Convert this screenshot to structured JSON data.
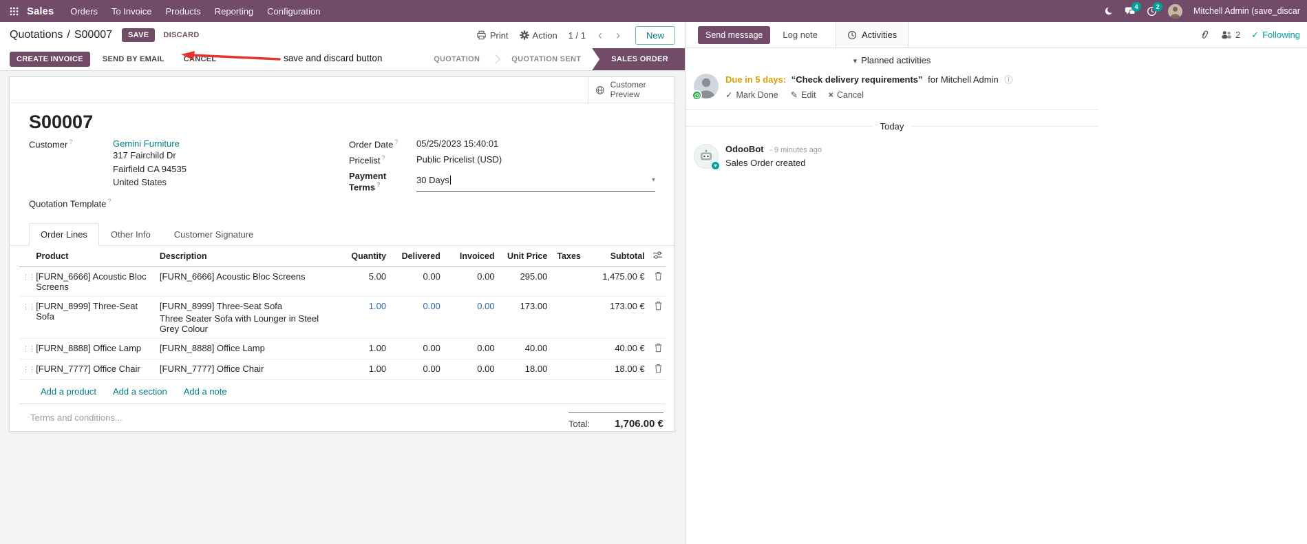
{
  "icons": {
    "help": "?",
    "prev": "‹",
    "next": "›",
    "caret_down": "▾",
    "check": "✓",
    "pencil": "✎",
    "cross": "×",
    "info": "ⓘ",
    "handle": "⋮⋮",
    "heart": "♥"
  },
  "topbar": {
    "app": "Sales",
    "menus": [
      "Orders",
      "To Invoice",
      "Products",
      "Reporting",
      "Configuration"
    ],
    "chat_badge": "4",
    "activity_badge": "2",
    "user": "Mitchell Admin (save_discar"
  },
  "control": {
    "breadcrumb_parent": "Quotations",
    "breadcrumb_sep": "/",
    "breadcrumb_current": "S00007",
    "save": "SAVE",
    "discard": "DISCARD",
    "annotation": "save and discard button",
    "print": "Print",
    "action": "Action",
    "pager": "1 / 1",
    "new": "New"
  },
  "statusbar": {
    "create_invoice": "CREATE INVOICE",
    "send_by_email": "SEND BY EMAIL",
    "cancel": "CANCEL",
    "stages": [
      {
        "label": "QUOTATION"
      },
      {
        "label": "QUOTATION SENT"
      },
      {
        "label": "SALES ORDER"
      }
    ]
  },
  "form": {
    "preview": "Customer Preview",
    "title": "S00007",
    "customer_label": "Customer",
    "customer": "Gemini Furniture",
    "address": [
      "317 Fairchild Dr",
      "Fairfield CA 94535",
      "United States"
    ],
    "quotation_template_label": "Quotation Template",
    "order_date_label": "Order Date",
    "order_date": "05/25/2023 15:40:01",
    "pricelist_label": "Pricelist",
    "pricelist": "Public Pricelist (USD)",
    "payment_terms_label": "Payment Terms",
    "payment_terms": "30 Days",
    "tabs": [
      "Order Lines",
      "Other Info",
      "Customer Signature"
    ]
  },
  "lines": {
    "headers": [
      "Product",
      "Description",
      "Quantity",
      "Delivered",
      "Invoiced",
      "Unit Price",
      "Taxes",
      "Subtotal"
    ],
    "rows": [
      {
        "product": "[FURN_6666] Acoustic Bloc Screens",
        "description": "[FURN_6666] Acoustic Bloc Screens",
        "quantity": "5.00",
        "delivered": "0.00",
        "invoiced": "0.00",
        "unit_price": "295.00",
        "taxes": "",
        "subtotal": "1,475.00 €"
      },
      {
        "product": "[FURN_8999] Three-Seat Sofa",
        "description": "[FURN_8999] Three-Seat Sofa",
        "description2": "Three Seater Sofa with Lounger in Steel Grey Colour",
        "quantity": "1.00",
        "delivered": "0.00",
        "invoiced": "0.00",
        "unit_price": "173.00",
        "taxes": "",
        "subtotal": "173.00 €"
      },
      {
        "product": "[FURN_8888] Office Lamp",
        "description": "[FURN_8888] Office Lamp",
        "quantity": "1.00",
        "delivered": "0.00",
        "invoiced": "0.00",
        "unit_price": "40.00",
        "taxes": "",
        "subtotal": "40.00 €"
      },
      {
        "product": "[FURN_7777] Office Chair",
        "description": "[FURN_7777] Office Chair",
        "quantity": "1.00",
        "delivered": "0.00",
        "invoiced": "0.00",
        "unit_price": "18.00",
        "taxes": "",
        "subtotal": "18.00 €"
      }
    ],
    "add_product": "Add a product",
    "add_section": "Add a section",
    "add_note": "Add a note",
    "terms_placeholder": "Terms and conditions...",
    "total_label": "Total:",
    "total": "1,706.00 €"
  },
  "chatter": {
    "send_message": "Send message",
    "log_note": "Log note",
    "activities_tab": "Activities",
    "followers_count": "2",
    "following": "Following",
    "planned_title": "Planned activities",
    "activity": {
      "due": "Due in 5 days:",
      "summary": "“Check delivery requirements”",
      "assignee": "for Mitchell Admin",
      "mark_done": "Mark Done",
      "edit": "Edit",
      "cancel": "Cancel"
    },
    "date_divider": "Today",
    "message": {
      "author": "OdooBot",
      "time": "- 9 minutes ago",
      "body": "Sales Order created"
    }
  },
  "colors": {
    "primary": "#714B67",
    "link": "#017E84",
    "highlight_blue": "#2E64B0",
    "warning": "#D9A000",
    "badge_teal": "#00A09D",
    "success_green": "#28A745",
    "annotation_red": "#E53333"
  }
}
